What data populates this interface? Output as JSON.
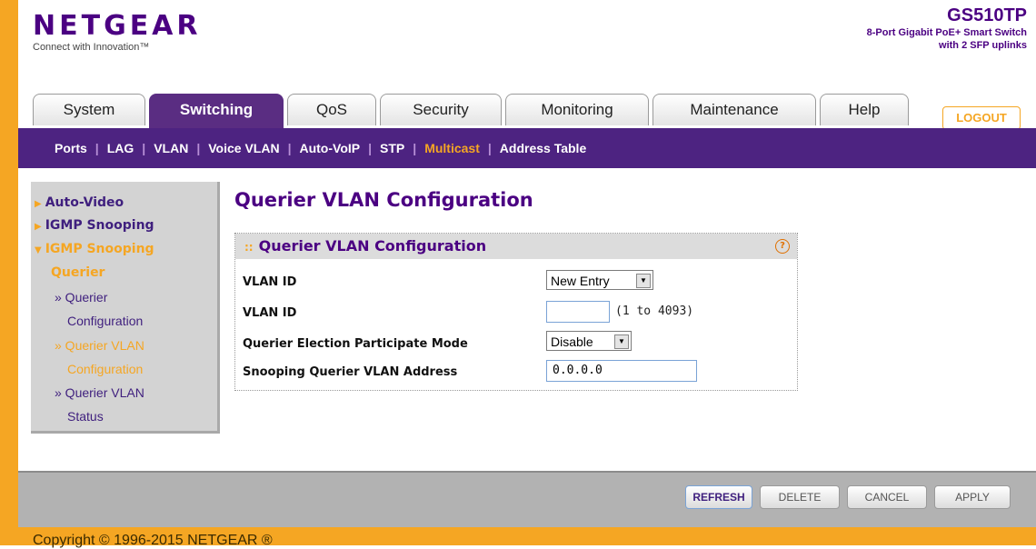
{
  "header": {
    "brand": "NETGEAR",
    "tagline": "Connect with Innovation™",
    "model_name": "GS510TP",
    "model_desc": "8-Port Gigabit PoE+ Smart Switch\nwith 2 SFP uplinks"
  },
  "tabs": [
    {
      "label": "System"
    },
    {
      "label": "Switching"
    },
    {
      "label": "QoS"
    },
    {
      "label": "Security"
    },
    {
      "label": "Monitoring"
    },
    {
      "label": "Maintenance"
    },
    {
      "label": "Help"
    }
  ],
  "active_tab": "Switching",
  "logout_label": "LOGOUT",
  "subnav": {
    "items": [
      "Ports",
      "LAG",
      "VLAN",
      "Voice VLAN",
      "Auto-VoIP",
      "STP",
      "Multicast",
      "Address Table"
    ],
    "active": "Multicast"
  },
  "leftmenu": {
    "auto_video": "Auto-Video",
    "igmp_snooping": "IGMP Snooping",
    "igmp_querier_1": "IGMP Snooping",
    "igmp_querier_2": "Querier",
    "querier_config_1": "» Querier",
    "querier_config_2": "Configuration",
    "querier_vlan_config_1": "» Querier VLAN",
    "querier_vlan_config_2": "Configuration",
    "querier_vlan_status_1": "» Querier VLAN",
    "querier_vlan_status_2": "Status"
  },
  "content": {
    "page_title": "Querier VLAN Configuration",
    "panel_title": "Querier VLAN Configuration",
    "help_icon": "?",
    "fields": {
      "vlan_select_label": "VLAN ID",
      "vlan_select_value": "New Entry",
      "vlan_input_label": "VLAN ID",
      "vlan_input_value": "",
      "vlan_range": "(1 to 4093)",
      "election_label": "Querier Election Participate Mode",
      "election_value": "Disable",
      "address_label": "Snooping Querier VLAN Address",
      "address_value": "0.0.0.0"
    }
  },
  "buttons": {
    "refresh": "REFRESH",
    "delete": "DELETE",
    "cancel": "CANCEL",
    "apply": "APPLY"
  },
  "copyright": "Copyright © 1996-2015 NETGEAR ®",
  "colors": {
    "brand_purple": "#4d2381",
    "accent_orange": "#f5a623"
  }
}
